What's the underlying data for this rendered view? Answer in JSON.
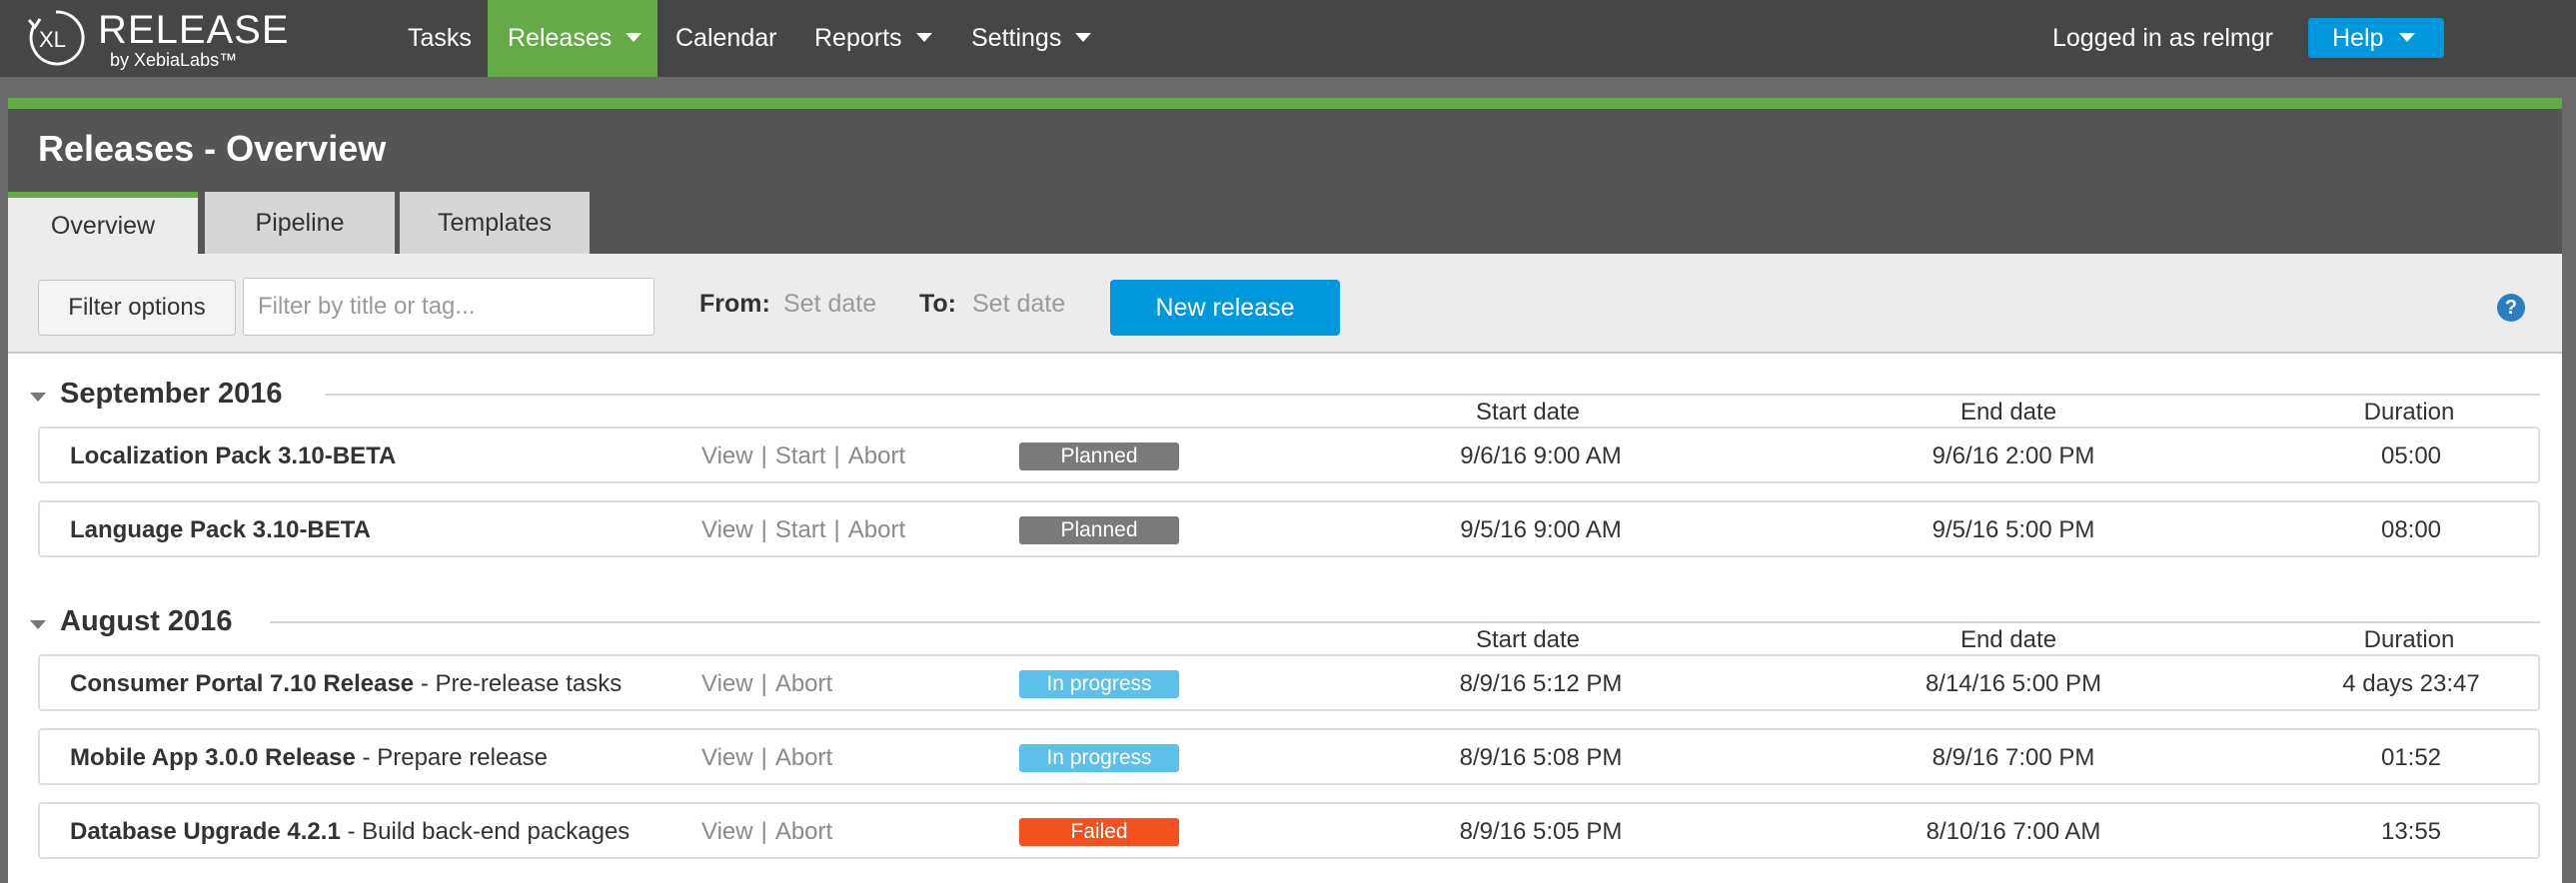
{
  "logo": {
    "title": "RELEASE",
    "subtitle": "by XebiaLabs™",
    "mark": "XL"
  },
  "nav": {
    "tasks": "Tasks",
    "releases": "Releases",
    "calendar": "Calendar",
    "reports": "Reports",
    "settings": "Settings",
    "logged_in": "Logged in as relmgr",
    "help": "Help"
  },
  "page": {
    "title": "Releases - Overview"
  },
  "tabs": [
    {
      "label": "Overview",
      "active": true
    },
    {
      "label": "Pipeline",
      "active": false
    },
    {
      "label": "Templates",
      "active": false
    }
  ],
  "toolbar": {
    "filter_options": "Filter options",
    "filter_placeholder": "Filter by title or tag...",
    "from_label": "From:",
    "from_value": "Set date",
    "to_label": "To:",
    "to_value": "Set date",
    "new_release": "New release",
    "help_icon": "?"
  },
  "columns": {
    "start": "Start date",
    "end": "End date",
    "duration": "Duration"
  },
  "action_labels": {
    "view": "View",
    "start": "Start",
    "abort": "Abort",
    "separator": "|"
  },
  "status_colors": {
    "Planned": "#7a7a7a",
    "In progress": "#5bc0ea",
    "Failed": "#f4511e"
  },
  "groups": [
    {
      "title": "September 2016",
      "releases": [
        {
          "name": "Localization Pack 3.10-BETA",
          "phase": "",
          "actions": [
            "View",
            "Start",
            "Abort"
          ],
          "status": "Planned",
          "start": "9/6/16 9:00 AM",
          "end": "9/6/16 2:00 PM",
          "duration": "05:00"
        },
        {
          "name": "Language Pack 3.10-BETA",
          "phase": "",
          "actions": [
            "View",
            "Start",
            "Abort"
          ],
          "status": "Planned",
          "start": "9/5/16 9:00 AM",
          "end": "9/5/16 5:00 PM",
          "duration": "08:00"
        }
      ]
    },
    {
      "title": "August 2016",
      "releases": [
        {
          "name": "Consumer Portal 7.10 Release",
          "phase": " - Pre-release tasks",
          "actions": [
            "View",
            "Abort"
          ],
          "status": "In progress",
          "start": "8/9/16 5:12 PM",
          "end": "8/14/16 5:00 PM",
          "duration": "4 days 23:47"
        },
        {
          "name": "Mobile App 3.0.0 Release",
          "phase": " - Prepare release",
          "actions": [
            "View",
            "Abort"
          ],
          "status": "In progress",
          "start": "8/9/16 5:08 PM",
          "end": "8/9/16 7:00 PM",
          "duration": "01:52"
        },
        {
          "name": "Database Upgrade 4.2.1",
          "phase": " - Build back-end packages",
          "actions": [
            "View",
            "Abort"
          ],
          "status": "Failed",
          "start": "8/9/16 5:05 PM",
          "end": "8/10/16 7:00 AM",
          "duration": "13:55"
        }
      ]
    }
  ]
}
